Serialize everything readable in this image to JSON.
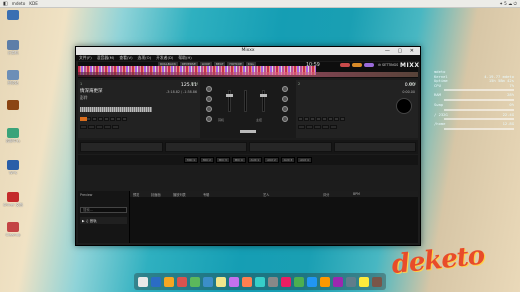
{
  "topbar": {
    "apps_label": "mdeto",
    "menu_label": "KDE",
    "right_status": "✦ 5 ☁ ⏻"
  },
  "desktop_icons": [
    {
      "label": "",
      "color": "#3a6fb2"
    },
    {
      "label": "计算机",
      "color": "#5d7ea8"
    },
    {
      "label": "回收站",
      "color": "#6d8fb7"
    },
    {
      "label": "",
      "color": "#8b4513"
    },
    {
      "label": "控制中心",
      "color": "#3ba37a"
    },
    {
      "label": "WPS",
      "color": "#2a5ea8"
    },
    {
      "label": "Shiver 文档",
      "color": "#c42b2b"
    },
    {
      "label": "Cleanup",
      "color": "#c34444"
    }
  ],
  "sysmon": {
    "lines": [
      {
        "k": "mdeto",
        "v": ""
      },
      {
        "k": "Kernel",
        "v": "4.19.77 mdeto"
      },
      {
        "k": "Uptime",
        "v": "15h 58m 42s"
      },
      {
        "k": "CPU",
        "v": "7%"
      },
      {
        "k": "RAM",
        "v": "28%"
      },
      {
        "k": "Swap",
        "v": "0%"
      },
      {
        "k": "/ 232G",
        "v": "22.4G"
      },
      {
        "k": "/home",
        "v": "12.8G"
      }
    ]
  },
  "logo_text": "deketo",
  "window": {
    "title": "Mixxx",
    "controls": "— ▢ ✕",
    "menu": [
      "文件(F)",
      "混音器(M)",
      "查看(V)",
      "选项(O)",
      "开发者(D)",
      "帮助(H)"
    ],
    "overview": {
      "labels": [
        "ROLLBACK",
        "REVERSE",
        "LOOP",
        "BEAT",
        "HOTCUE",
        "KILL"
      ],
      "clock": "10:59",
      "settings_label": "⚙ SETTINGS",
      "brand": "MIXX"
    },
    "deck_left": {
      "number": "1",
      "title": "情深海更深",
      "artist": "彭羚",
      "bpm": "125.11",
      "bpm_label": "BPM",
      "times": "-3:18.82 / -1:38.86",
      "key": "A#m",
      "sync_label": "SYNC"
    },
    "deck_right": {
      "number": "2",
      "title": "",
      "artist": "",
      "bpm": "0.00",
      "bpm_label": "BPM",
      "times": "0:00.00",
      "sync_label": "SYNC"
    },
    "mixer": {
      "labels": [
        "GAIN",
        "HIGH",
        "MID",
        "LOW",
        "FX",
        "耳机",
        "主控"
      ]
    },
    "fx_buttons": [
      "MIC 1",
      "MIC 2",
      "MIC 3",
      "MIC 4",
      "AUX 1",
      "AUX 2",
      "AUX 3",
      "AUX 4"
    ],
    "library": {
      "preview_label": "Preview",
      "search_placeholder": "搜索...",
      "tree_item": "▶ ♫ 音轨",
      "columns": [
        "预览",
        "封面面",
        "播放列表",
        "专辑",
        "艺人",
        "评分",
        "BPM"
      ]
    }
  },
  "dock_colors": [
    "#e8e8e8",
    "#2b6cc4",
    "#f5a623",
    "#d9534f",
    "#5cb85c",
    "#3b8ec9",
    "#f0e68c",
    "#c471ed",
    "#ff7f50",
    "#36cfc9",
    "#888",
    "#e91e63",
    "#4caf50",
    "#2196f3",
    "#ff9800",
    "#9c27b0",
    "#607d8b",
    "#ffeb3b",
    "#795548"
  ]
}
